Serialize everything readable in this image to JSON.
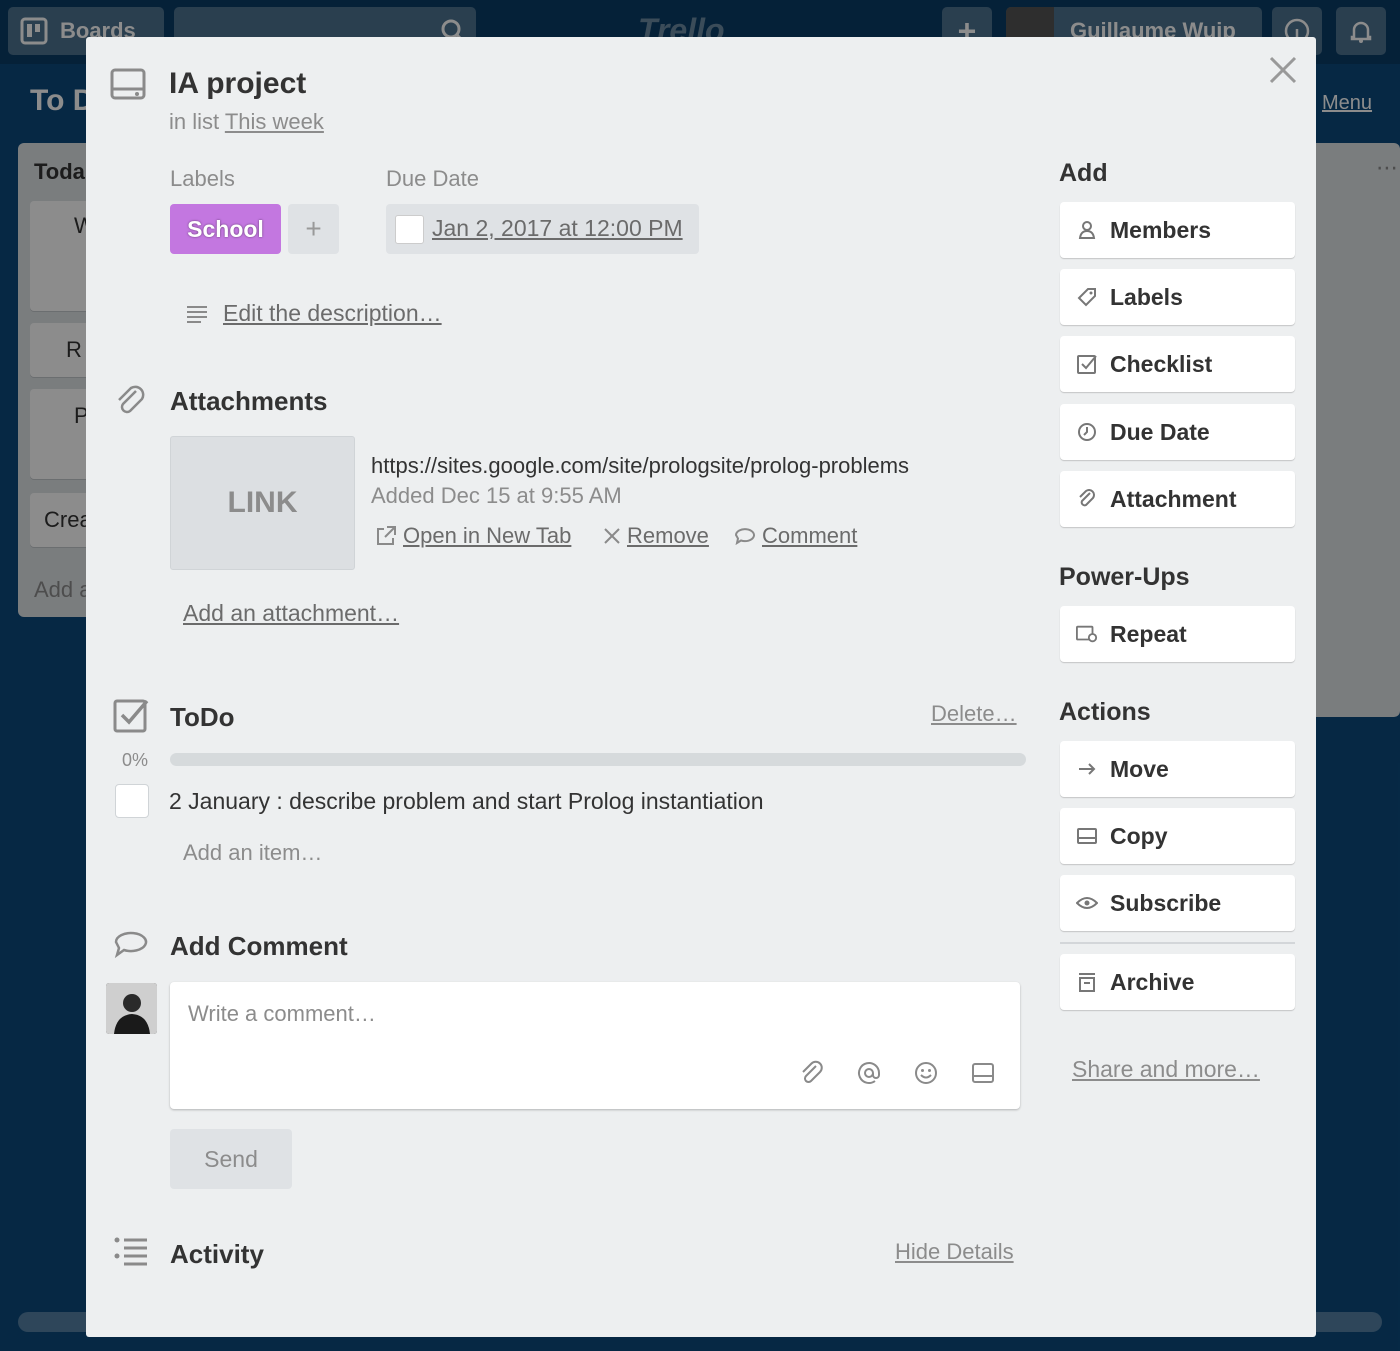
{
  "background": {
    "header": {
      "boards_label": "Boards",
      "logo": "Trello",
      "add_label": "+",
      "user_name": "Guillaume Wuip"
    },
    "board_title": "To D",
    "menu_label": "Menu",
    "list": {
      "title": "Toda",
      "cards": [
        "W",
        "R",
        "P",
        "Crea"
      ],
      "add_card": "Add a"
    }
  },
  "card": {
    "title": "IA project",
    "in_list_prefix": "in list",
    "list_name": "This week",
    "labels_heading": "Labels",
    "label": {
      "name": "School",
      "color": "#c377e0"
    },
    "add_label": "+",
    "due_heading": "Due Date",
    "due_value": "Jan 2, 2017 at 12:00 PM",
    "description_link": "Edit the description…",
    "attachments": {
      "heading": "Attachments",
      "items": [
        {
          "thumb": "LINK",
          "url": "https://sites.google.com/site/prologsite/prolog-problems",
          "added": "Added Dec 15 at 9:55 AM",
          "open": "Open in New Tab",
          "remove": "Remove",
          "comment": "Comment"
        }
      ],
      "add": "Add an attachment…"
    },
    "checklist": {
      "title": "ToDo",
      "delete": "Delete…",
      "progress": 0,
      "progress_label": "0%",
      "items": [
        {
          "text": "2 January : describe problem and start Prolog instantiation",
          "checked": false
        }
      ],
      "add_item": "Add an item…"
    },
    "comment": {
      "heading": "Add Comment",
      "placeholder": "Write a comment…",
      "send": "Send"
    },
    "activity": {
      "heading": "Activity",
      "toggle": "Hide Details"
    }
  },
  "sidebar": {
    "add_heading": "Add",
    "add": [
      {
        "label": "Members",
        "icon": "person-icon"
      },
      {
        "label": "Labels",
        "icon": "tag-icon"
      },
      {
        "label": "Checklist",
        "icon": "checkbox-icon"
      },
      {
        "label": "Due Date",
        "icon": "clock-icon"
      },
      {
        "label": "Attachment",
        "icon": "paperclip-icon"
      }
    ],
    "powerups_heading": "Power-Ups",
    "powerups": [
      {
        "label": "Repeat",
        "icon": "repeat-icon"
      }
    ],
    "actions_heading": "Actions",
    "actions": [
      {
        "label": "Move",
        "icon": "arrow-right-icon"
      },
      {
        "label": "Copy",
        "icon": "card-icon"
      },
      {
        "label": "Subscribe",
        "icon": "eye-icon"
      },
      {
        "label": "Archive",
        "icon": "archive-icon"
      }
    ],
    "share": "Share and more…"
  }
}
